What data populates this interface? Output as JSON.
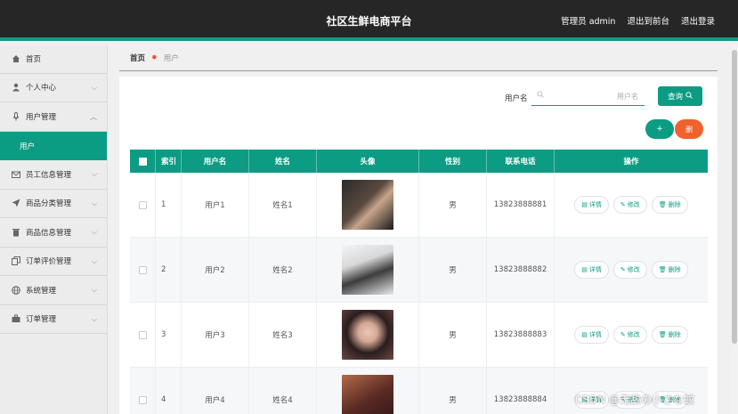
{
  "header": {
    "title": "社区生鲜电商平台",
    "user_label": "管理员 admin",
    "frontend_link": "退出到前台",
    "logout_link": "退出登录"
  },
  "sidebar": {
    "items": [
      {
        "label": "首页",
        "icon": "home-icon"
      },
      {
        "label": "个人中心",
        "icon": "user-icon"
      },
      {
        "label": "用户管理",
        "icon": "microphone-icon"
      },
      {
        "label": "用户",
        "icon": ""
      },
      {
        "label": "员工信息管理",
        "icon": "mail-icon"
      },
      {
        "label": "商品分类管理",
        "icon": "send-icon"
      },
      {
        "label": "商品信息管理",
        "icon": "trash-icon"
      },
      {
        "label": "订单评价管理",
        "icon": "copy-icon"
      },
      {
        "label": "系统管理",
        "icon": "globe-icon"
      },
      {
        "label": "订单管理",
        "icon": "briefcase-icon"
      }
    ]
  },
  "breadcrumb": {
    "home": "首页",
    "current": "用户"
  },
  "search": {
    "label": "用户名",
    "placeholder": "用户名",
    "button": "查询"
  },
  "actions": {
    "add": "+",
    "delete": "删"
  },
  "table": {
    "headers": [
      "",
      "索引",
      "用户名",
      "姓名",
      "头像",
      "性别",
      "联系电话",
      "操作"
    ],
    "rows": [
      {
        "index": "1",
        "username": "用户1",
        "name": "姓名1",
        "gender": "男",
        "phone": "13823888881"
      },
      {
        "index": "2",
        "username": "用户2",
        "name": "姓名2",
        "gender": "男",
        "phone": "13823888882"
      },
      {
        "index": "3",
        "username": "用户3",
        "name": "姓名3",
        "gender": "男",
        "phone": "13823888883"
      },
      {
        "index": "4",
        "username": "用户4",
        "name": "姓名4",
        "gender": "男",
        "phone": "13823888884"
      }
    ],
    "op_labels": {
      "detail": "详情",
      "edit": "修改",
      "delete": "删除"
    }
  },
  "watermark": "CSDN @无敌の小さな蚊",
  "colors": {
    "accent": "#0c9c84",
    "danger": "#f0622d",
    "topbar": "#262626"
  }
}
